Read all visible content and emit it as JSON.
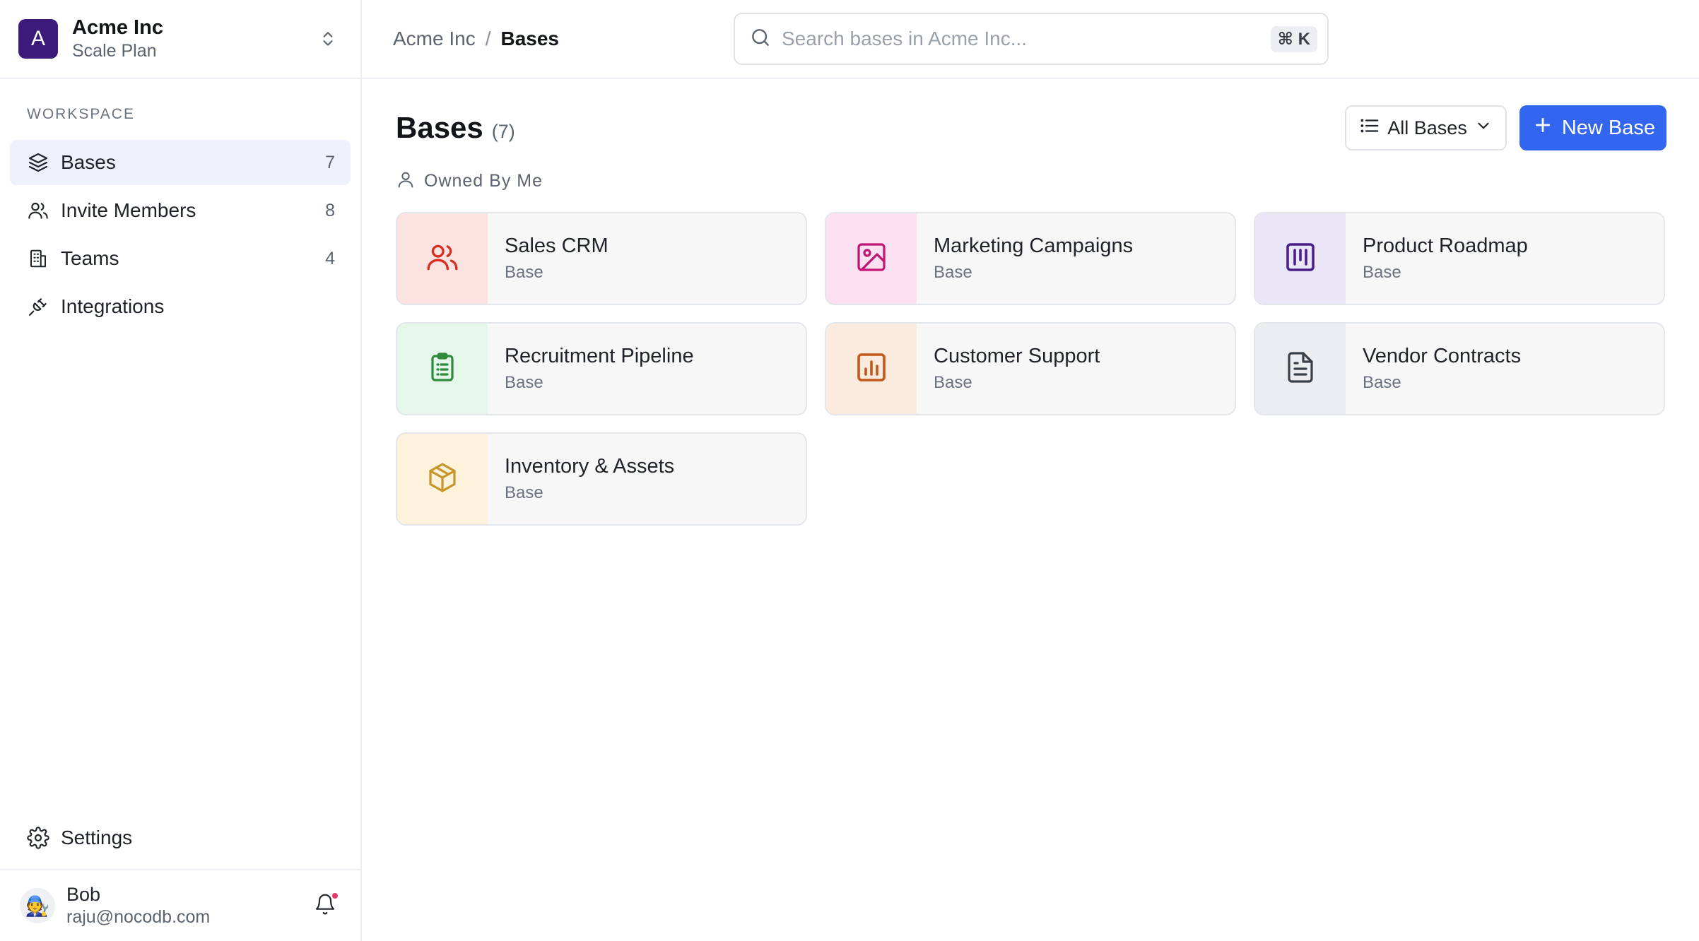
{
  "workspace": {
    "initial": "A",
    "name": "Acme Inc",
    "plan": "Scale Plan",
    "section_label": "WORKSPACE"
  },
  "nav": {
    "items": [
      {
        "label": "Bases",
        "count": "7",
        "icon": "layers-icon"
      },
      {
        "label": "Invite Members",
        "count": "8",
        "icon": "users-icon"
      },
      {
        "label": "Teams",
        "count": "4",
        "icon": "building-icon"
      },
      {
        "label": "Integrations",
        "count": "",
        "icon": "plug-icon"
      }
    ],
    "settings_label": "Settings"
  },
  "user": {
    "name": "Bob",
    "email": "raju@nocodb.com",
    "avatar": "🧑‍🔧"
  },
  "breadcrumb": {
    "root": "Acme Inc",
    "separator": "/",
    "current": "Bases"
  },
  "search": {
    "placeholder": "Search bases in Acme Inc...",
    "shortcut": "⌘ K"
  },
  "page": {
    "title": "Bases",
    "count": "(7)",
    "filter_label": "All Bases",
    "new_button_label": "New Base",
    "group_label": "Owned By Me"
  },
  "bases": [
    {
      "title": "Sales CRM",
      "subtitle": "Base",
      "icon": "users-icon",
      "tint": "#fbe3e2",
      "color": "#d92d20"
    },
    {
      "title": "Marketing Campaigns",
      "subtitle": "Base",
      "icon": "image-icon",
      "tint": "#fbe1f1",
      "color": "#c11574"
    },
    {
      "title": "Product Roadmap",
      "subtitle": "Base",
      "icon": "kanban-icon",
      "tint": "#ebe5f8",
      "color": "#4a1f8a"
    },
    {
      "title": "Recruitment Pipeline",
      "subtitle": "Base",
      "icon": "clipboard-icon",
      "tint": "#e5f6ea",
      "color": "#2f8a3c"
    },
    {
      "title": "Customer Support",
      "subtitle": "Base",
      "icon": "chart-icon",
      "tint": "#fbebde",
      "color": "#c4571a"
    },
    {
      "title": "Vendor Contracts",
      "subtitle": "Base",
      "icon": "file-icon",
      "tint": "#ebedf0",
      "color": "#3a4049"
    },
    {
      "title": "Inventory & Assets",
      "subtitle": "Base",
      "icon": "box-icon",
      "tint": "#fdf3dd",
      "color": "#c8952a"
    }
  ],
  "colors": {
    "accent": "#3366ee",
    "workspace_avatar": "#3b1a7a",
    "active_nav": "#eef0fb",
    "notification_dot": "#e23b6a"
  }
}
